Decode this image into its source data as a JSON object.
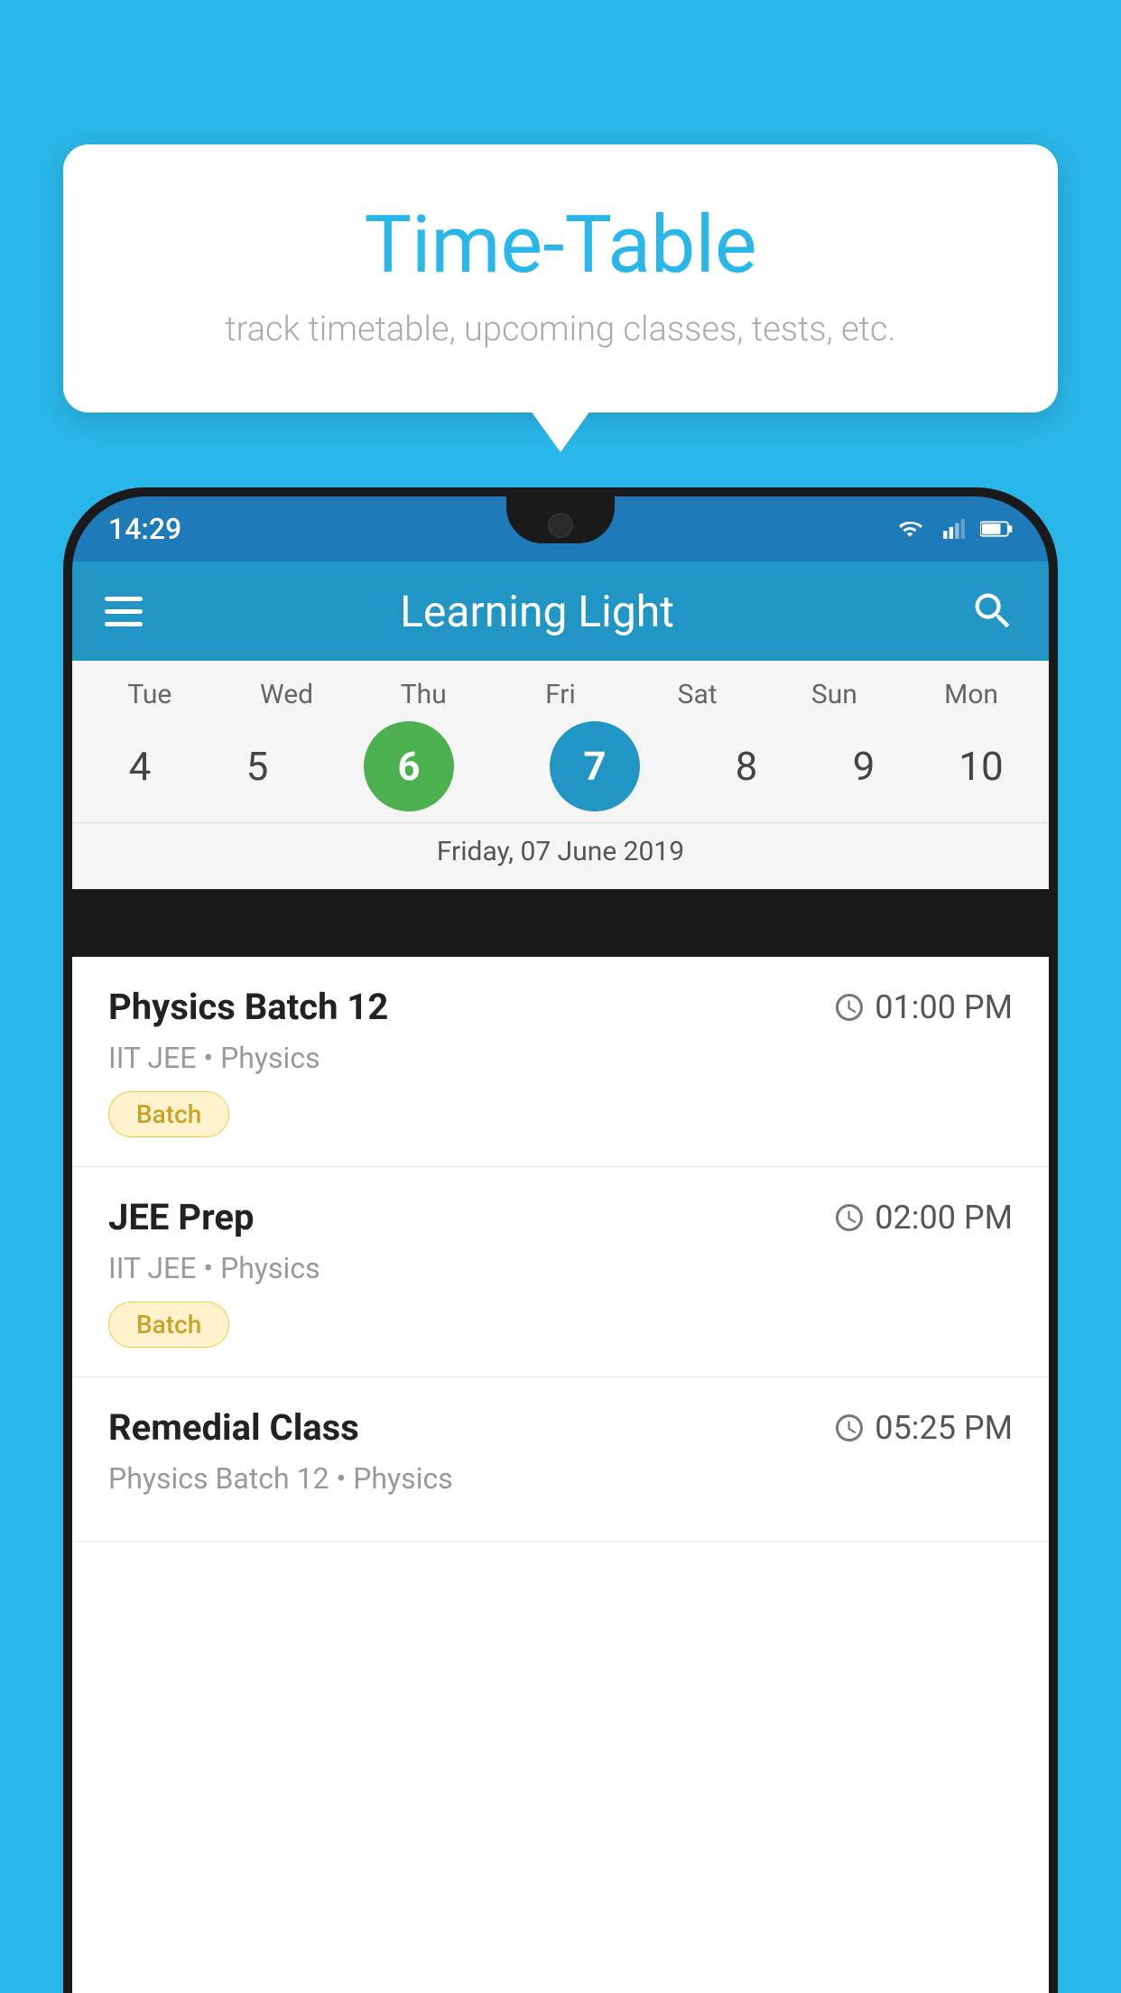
{
  "page": {
    "background_color": "#29b6e8"
  },
  "tooltip": {
    "title": "Time-Table",
    "subtitle": "track timetable, upcoming classes, tests, etc."
  },
  "status_bar": {
    "time": "14:29"
  },
  "app_bar": {
    "title": "Learning Light"
  },
  "calendar": {
    "selected_date_label": "Friday, 07 June 2019",
    "days": [
      {
        "name": "Tue",
        "number": "4",
        "state": "normal"
      },
      {
        "name": "Wed",
        "number": "5",
        "state": "normal"
      },
      {
        "name": "Thu",
        "number": "6",
        "state": "today"
      },
      {
        "name": "Fri",
        "number": "7",
        "state": "selected"
      },
      {
        "name": "Sat",
        "number": "8",
        "state": "normal"
      },
      {
        "name": "Sun",
        "number": "9",
        "state": "normal"
      },
      {
        "name": "Mon",
        "number": "10",
        "state": "normal"
      }
    ]
  },
  "schedule": {
    "items": [
      {
        "name": "Physics Batch 12",
        "time": "01:00 PM",
        "meta": "IIT JEE • Physics",
        "badge": "Batch"
      },
      {
        "name": "JEE Prep",
        "time": "02:00 PM",
        "meta": "IIT JEE • Physics",
        "badge": "Batch"
      },
      {
        "name": "Remedial Class",
        "time": "05:25 PM",
        "meta": "Physics Batch 12 • Physics",
        "badge": null
      }
    ]
  }
}
